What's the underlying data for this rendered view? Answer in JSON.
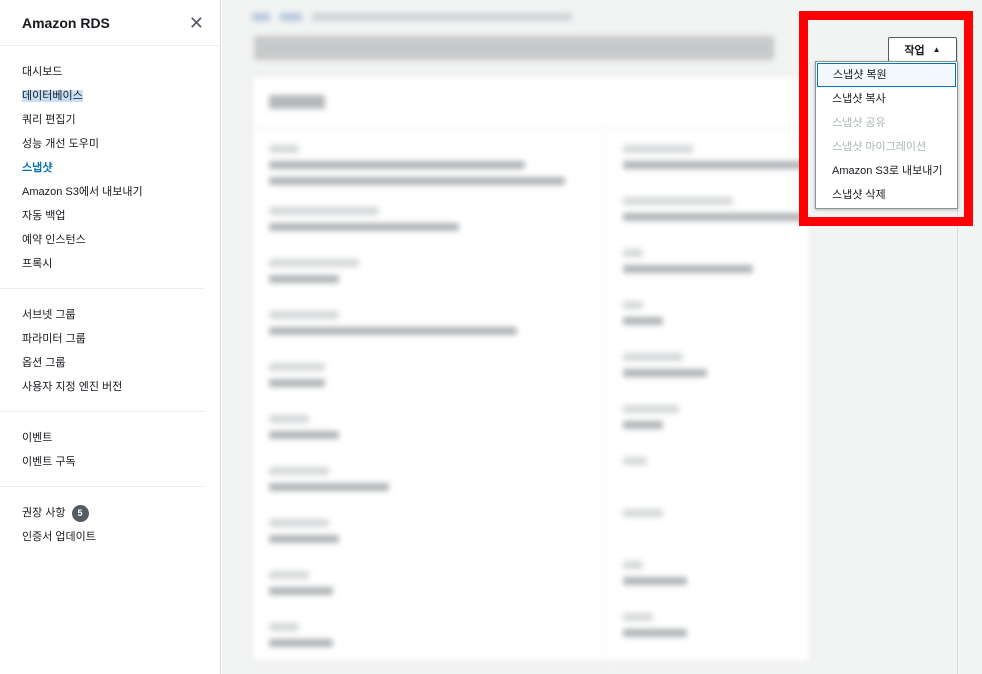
{
  "sidebar": {
    "title": "Amazon RDS",
    "close_icon": "close-icon",
    "groups": [
      {
        "items": [
          {
            "label": "대시보드"
          },
          {
            "label": "데이터베이스"
          },
          {
            "label": "쿼리 편집기"
          },
          {
            "label": "성능 개선 도우미"
          },
          {
            "label": "스냅샷"
          },
          {
            "label": "Amazon S3에서 내보내기"
          },
          {
            "label": "자동 백업"
          },
          {
            "label": "예약 인스턴스"
          },
          {
            "label": "프록시"
          }
        ]
      },
      {
        "items": [
          {
            "label": "서브넷 그룹"
          },
          {
            "label": "파라미터 그룹"
          },
          {
            "label": "옵션 그룹"
          },
          {
            "label": "사용자 지정 엔진 버전"
          }
        ]
      },
      {
        "items": [
          {
            "label": "이벤트"
          },
          {
            "label": "이벤트 구독"
          }
        ]
      },
      {
        "items": [
          {
            "label": "권장 사항",
            "badge": "5"
          },
          {
            "label": "인증서 업데이트"
          }
        ]
      }
    ]
  },
  "actions": {
    "button_label": "작업",
    "caret_icon": "caret-up-icon",
    "menu": [
      {
        "label": "스냅샷 복원",
        "state": "focused"
      },
      {
        "label": "스냅샷 복사",
        "state": "enabled"
      },
      {
        "label": "스냅샷 공유",
        "state": "disabled"
      },
      {
        "label": "스냅샷 마이그레이션",
        "state": "disabled"
      },
      {
        "label": "Amazon S3로 내보내기",
        "state": "enabled"
      },
      {
        "label": "스냅샷 삭제",
        "state": "enabled"
      }
    ]
  },
  "colors": {
    "accent": "#0073bb",
    "highlight_box": "#ff0000",
    "disabled_text": "#aab7b8"
  }
}
